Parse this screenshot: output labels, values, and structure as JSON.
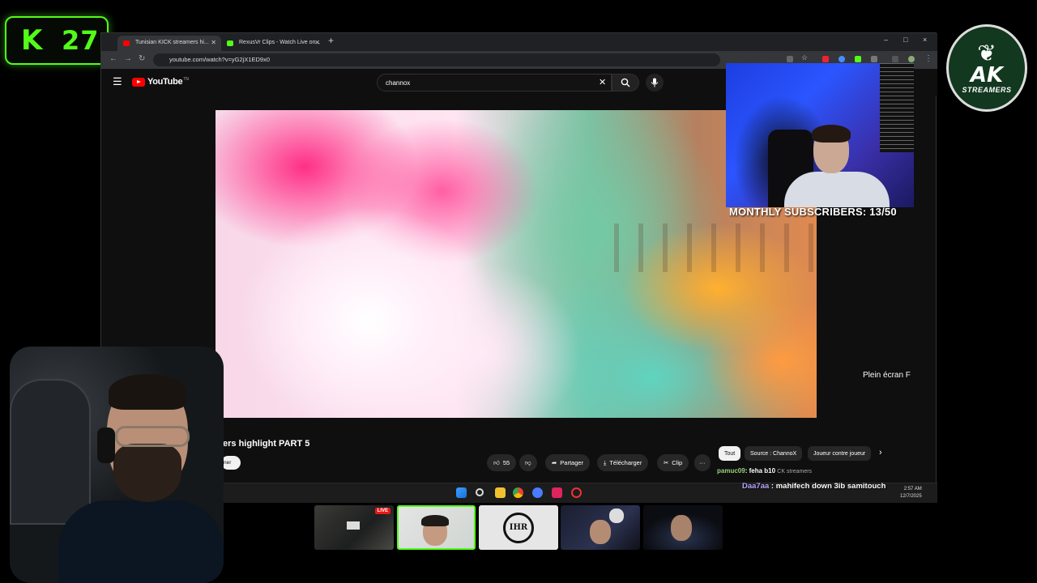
{
  "overlay": {
    "kick_logo": "K",
    "kick_count": "27",
    "ak_logo_text": "AK",
    "ak_logo_sub": "STREAMERS",
    "subscriber_goal": "MONTHLY SUBSCRIBERS: 13/50",
    "chat": [
      {
        "user": "pamuc09",
        "message": ": feha b10",
        "extra": "CK streamers"
      },
      {
        "user": "Daa7aa",
        "message": " : mahifech down 3ib samitouch"
      }
    ],
    "live_badge": "LIVE",
    "team_logo": "IHR"
  },
  "browser": {
    "tabs": [
      {
        "title": "Tunisian KICK streamers hi...",
        "active": true,
        "favicon_color": "#ff0000"
      },
      {
        "title": "RexusVr Clips - Watch Live on...",
        "active": false,
        "favicon_color": "#53fc18"
      }
    ],
    "url": "youtube.com/watch?v=yG2jX1ED9x0",
    "new_tab": "+",
    "window_controls": [
      "–",
      "□",
      "×"
    ]
  },
  "youtube": {
    "logo_text": "YouTube",
    "logo_tn": "TN",
    "search_query": "channox",
    "fullscreen_hint": "Plein écran F",
    "video_title": "ers highlight PART 5",
    "subscribe_label": "ner",
    "like_count": "55",
    "share_label": "Partager",
    "download_label": "Télécharger",
    "clip_label": "Clip",
    "more_label": "···",
    "chips": [
      "Tout",
      "Source : ChannoX",
      "Joueur contre joueur"
    ]
  },
  "taskbar": {
    "time": "2:57 AM",
    "date": "12/7/2025"
  },
  "colors": {
    "kick_green": "#53fc18",
    "youtube_red": "#ff0000",
    "ak_green": "#12381f"
  }
}
